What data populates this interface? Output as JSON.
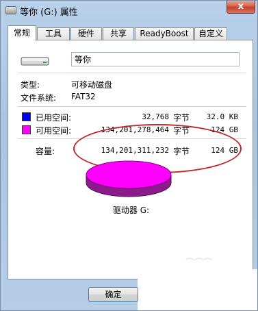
{
  "window": {
    "title": "等你 (G:) 属性",
    "close_label": "x"
  },
  "tabs": [
    {
      "label": "常规"
    },
    {
      "label": "工具"
    },
    {
      "label": "硬件"
    },
    {
      "label": "共享"
    },
    {
      "label": "ReadyBoost"
    },
    {
      "label": "自定义"
    }
  ],
  "general": {
    "drive_name_value": "等你",
    "type_label": "类型:",
    "type_value": "可移动磁盘",
    "fs_label": "文件系统:",
    "fs_value": "FAT32",
    "used": {
      "label": "已用空间:",
      "bytes": "32,768",
      "unit": "字节",
      "size": "32.0 KB",
      "color": "#0000ff"
    },
    "free": {
      "label": "可用空间:",
      "bytes": "134,201,278,464",
      "unit": "字节",
      "size": "124 GB",
      "color": "#ff00ff"
    },
    "capacity": {
      "label": "容量:",
      "bytes": "134,201,311,232",
      "unit": "字节",
      "size": "124 GB"
    },
    "drive_label": "驱动器 G:"
  },
  "buttons": {
    "ok_label": "确定"
  },
  "colors": {
    "annotation_oval": "#c0272d",
    "pie_free": "#ff00ff"
  }
}
